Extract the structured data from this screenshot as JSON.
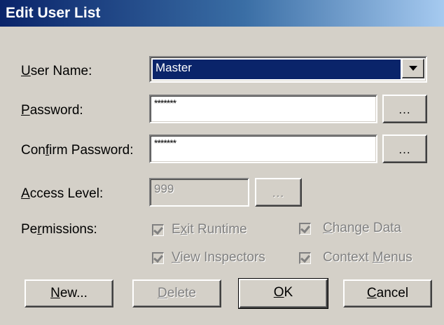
{
  "window": {
    "title": "Edit User List"
  },
  "form": {
    "user_name": {
      "label_prefix": "",
      "label_mnemonic": "U",
      "label_rest": "ser Name:",
      "value": "Master"
    },
    "password": {
      "label_prefix": "",
      "label_mnemonic": "P",
      "label_rest": "assword:",
      "value": "*******",
      "browse_label": "..."
    },
    "confirm_password": {
      "label_prefix": "Con",
      "label_mnemonic": "f",
      "label_rest": "irm Password:",
      "value": "*******",
      "browse_label": "..."
    },
    "access_level": {
      "label_prefix": "",
      "label_mnemonic": "A",
      "label_rest": "ccess Level:",
      "value": "999",
      "browse_label": "..."
    },
    "permissions": {
      "label_prefix": "Pe",
      "label_mnemonic": "r",
      "label_rest": "missions:",
      "items": [
        {
          "prefix": "E",
          "mnemonic": "x",
          "rest": "it Runtime",
          "checked": true
        },
        {
          "prefix": "",
          "mnemonic": "C",
          "rest": "hange Data",
          "checked": true
        },
        {
          "prefix": "",
          "mnemonic": "V",
          "rest": "iew Inspectors",
          "checked": true
        },
        {
          "prefix": "Context ",
          "mnemonic": "M",
          "rest": "enus",
          "checked": true
        }
      ]
    }
  },
  "buttons": {
    "new": {
      "prefix": "",
      "mnemonic": "N",
      "rest": "ew..."
    },
    "delete": {
      "prefix": "",
      "mnemonic": "D",
      "rest": "elete"
    },
    "ok": {
      "prefix": "",
      "mnemonic": "O",
      "rest": "K"
    },
    "cancel": {
      "prefix": "",
      "mnemonic": "C",
      "rest": "ancel"
    }
  },
  "colors": {
    "face": "#d4d0c8",
    "title_start": "#0a246a",
    "title_end": "#a6caf0",
    "selection": "#0a246a",
    "disabled_text": "#808080"
  }
}
